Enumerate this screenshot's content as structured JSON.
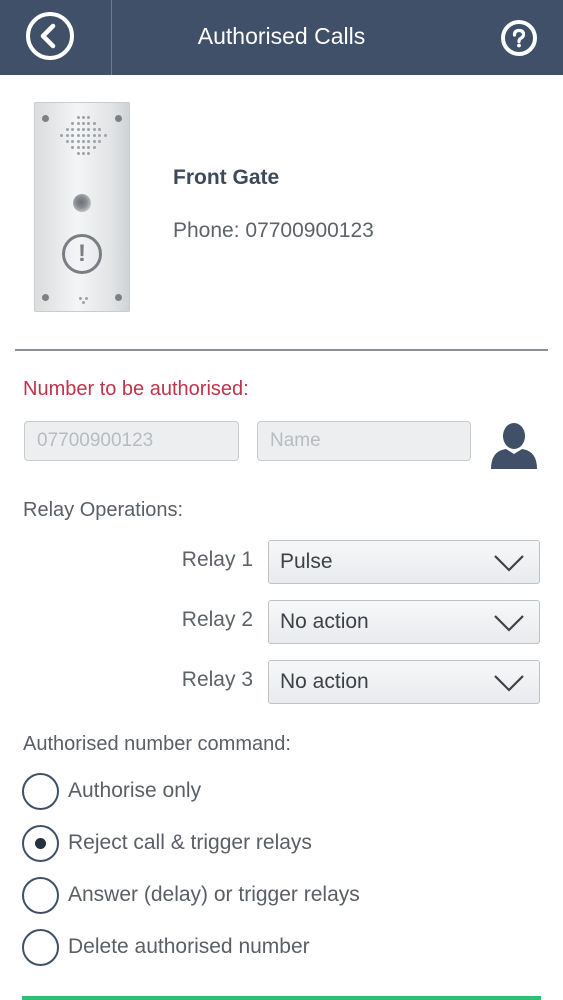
{
  "header": {
    "title": "Authorised Calls",
    "back_icon": "back-circle-icon",
    "help_icon": "help-circle-icon"
  },
  "device": {
    "name": "Front Gate",
    "phone": "Phone: 07700900123",
    "image_icon": "intercom-panel-icon"
  },
  "authorise": {
    "heading": "Number to be authorised:",
    "number_value": "07700900123",
    "name_placeholder": "Name",
    "contact_icon": "contact-person-icon"
  },
  "relays": {
    "heading": "Relay Operations:",
    "items": [
      {
        "label": "Relay 1",
        "value": "Pulse"
      },
      {
        "label": "Relay 2",
        "value": "No action"
      },
      {
        "label": "Relay 3",
        "value": "No action"
      }
    ]
  },
  "command": {
    "heading": "Authorised number command:",
    "options": [
      {
        "label": "Authorise only",
        "selected": false
      },
      {
        "label": "Reject call & trigger relays",
        "selected": true
      },
      {
        "label": "Answer (delay) or trigger relays",
        "selected": false
      },
      {
        "label": "Delete authorised number",
        "selected": false
      }
    ]
  },
  "colors": {
    "header_bg": "#3f5068",
    "accent_red": "#c0334d",
    "accent_green": "#2fbf71"
  }
}
